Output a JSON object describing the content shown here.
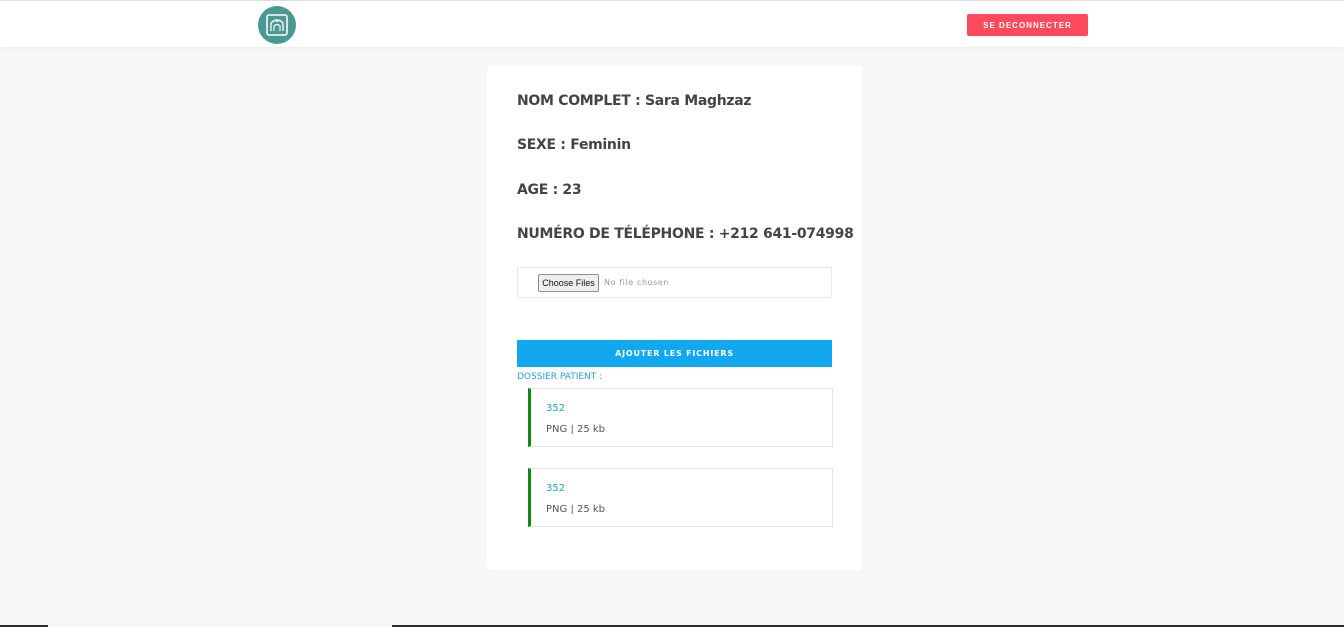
{
  "header": {
    "logo_icon": "hospital-logo-icon",
    "logout_label": "SE DECONNECTER",
    "logout_color": "#ff4a5c"
  },
  "patient": {
    "name_line": "NOM COMPLET : Sara Maghzaz",
    "sex_line": "SEXE : Feminin",
    "age_line": "AGE : 23",
    "phone_line": "NUMÉRO DE TÉLÉPHONE : +212 641-074998"
  },
  "upload": {
    "choose_label": "Choose Files",
    "status_text": "No file chosen",
    "submit_label": "AJOUTER LES FICHIERS",
    "submit_color": "#12a8ef"
  },
  "dossier": {
    "label": "DOSSIER PATIENT :",
    "files": [
      {
        "name": "352",
        "meta": "PNG | 25 kb"
      },
      {
        "name": "352",
        "meta": "PNG | 25 kb"
      }
    ]
  }
}
